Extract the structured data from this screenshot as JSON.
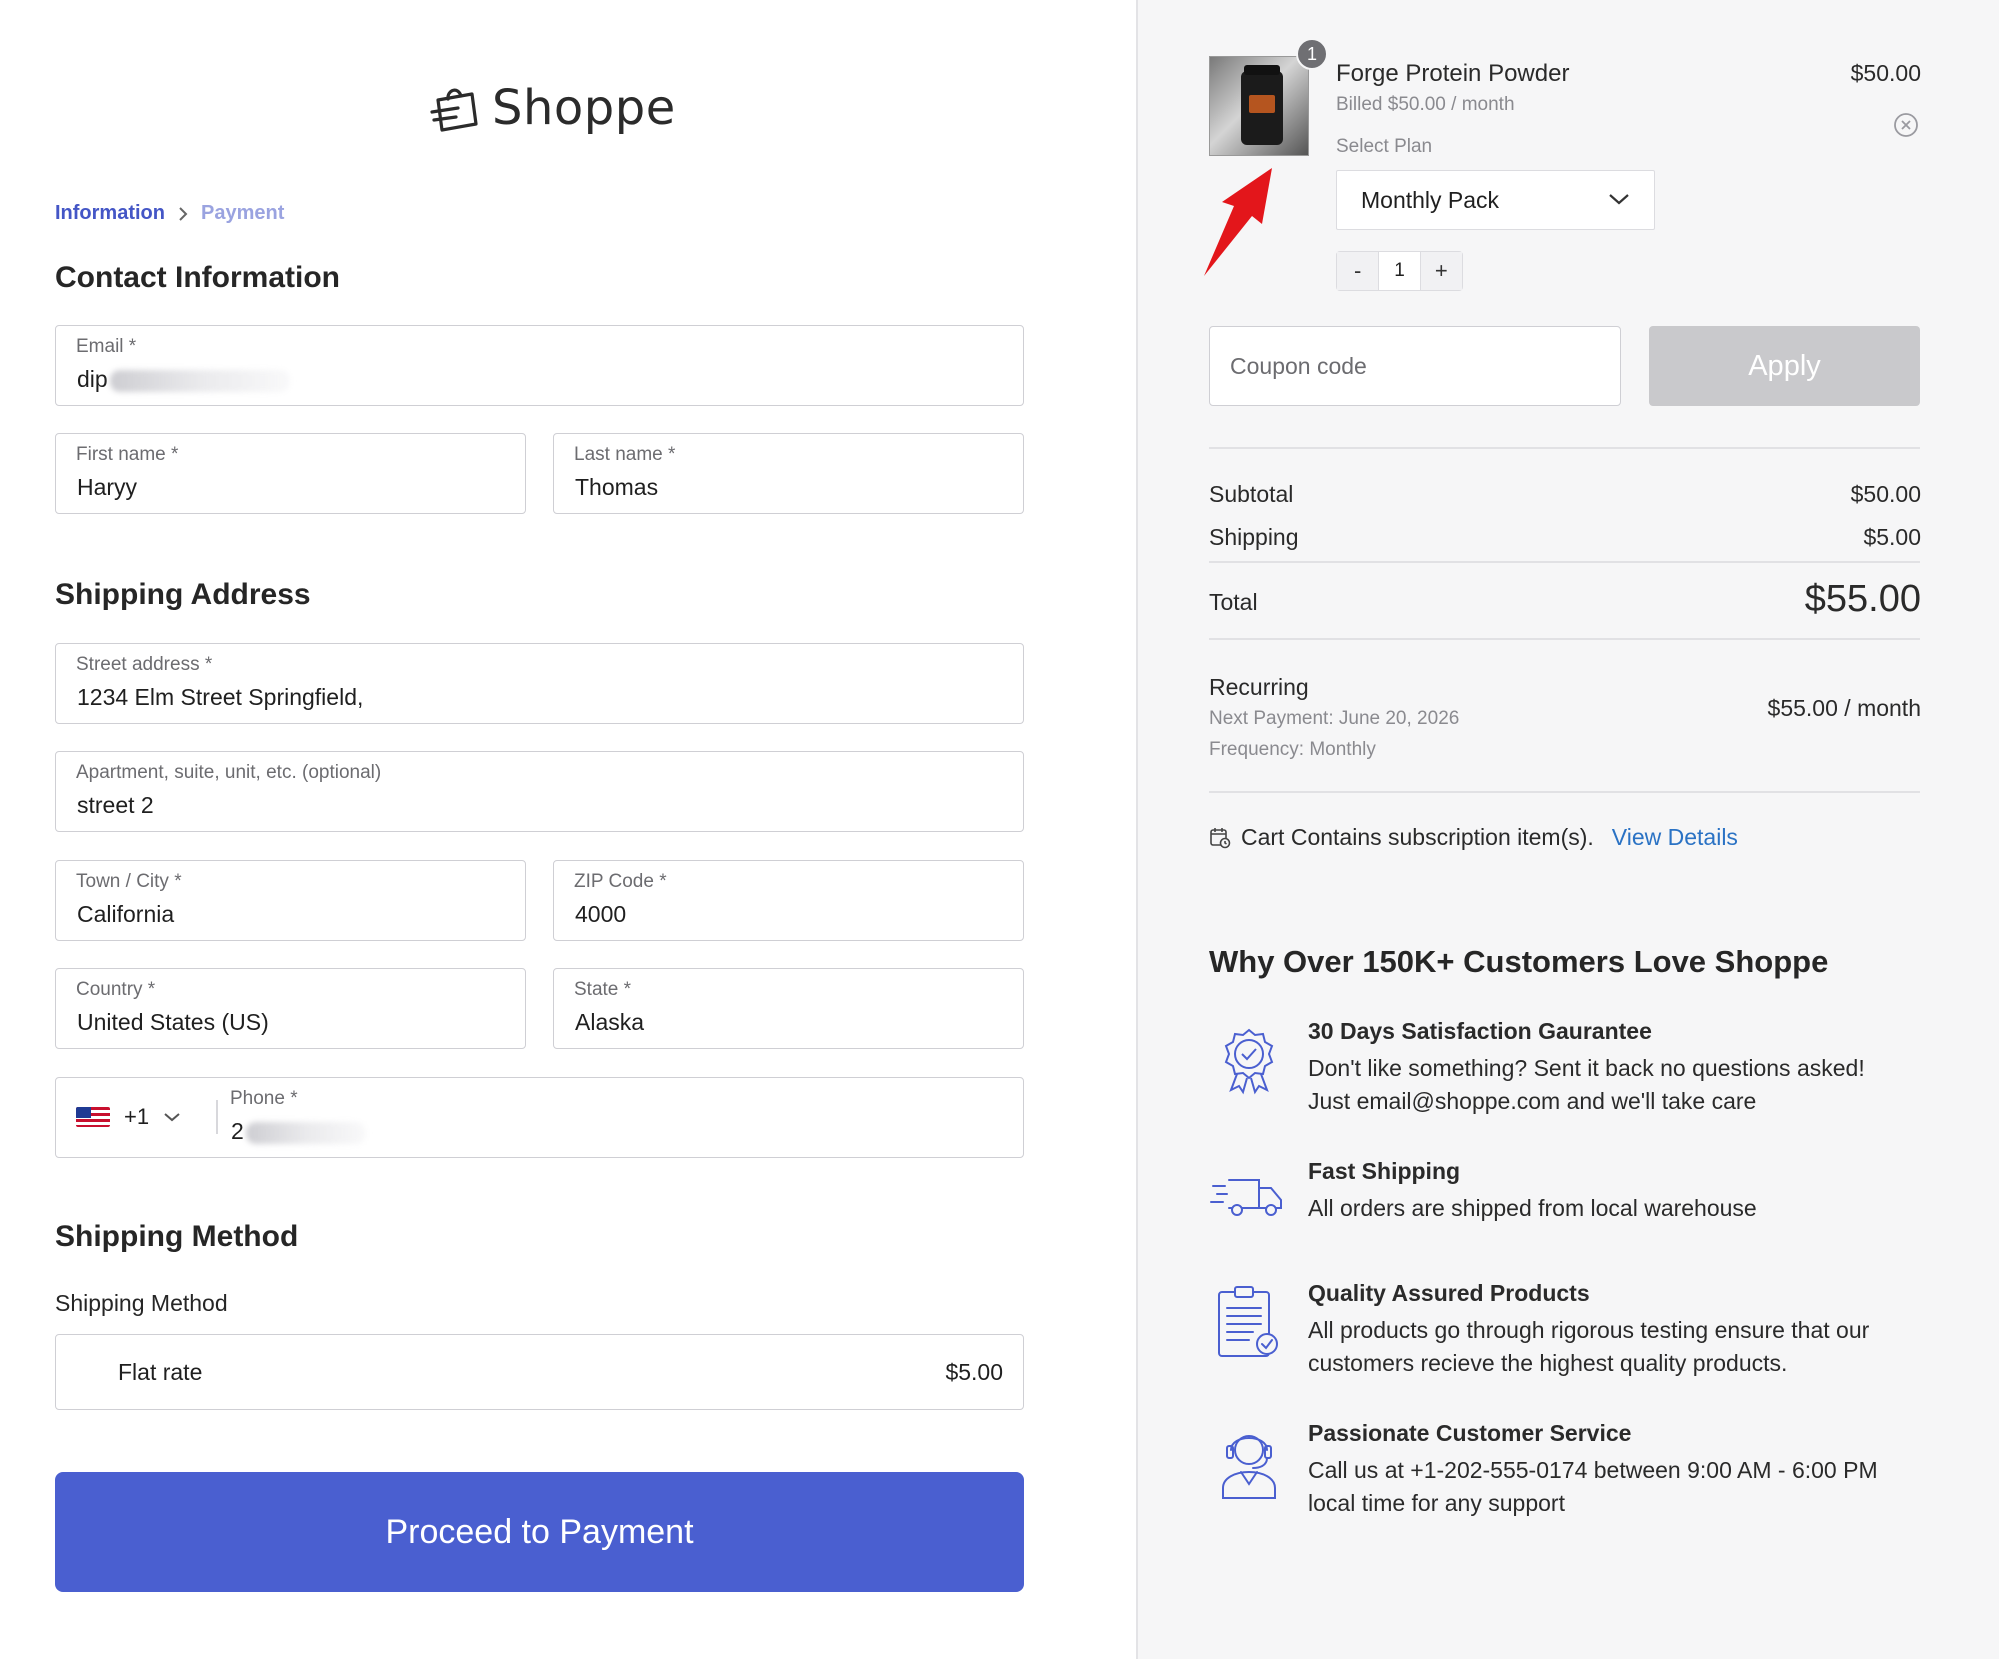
{
  "brand": {
    "name": "Shoppe",
    "accent": "#4a5fd0"
  },
  "breadcrumb": {
    "current": "Information",
    "next": "Payment"
  },
  "contact": {
    "title": "Contact Information",
    "email_label": "Email *",
    "email_value": "dip",
    "first_name_label": "First name *",
    "first_name_value": "Haryy",
    "last_name_label": "Last name *",
    "last_name_value": "Thomas"
  },
  "shipping_address": {
    "title": "Shipping Address",
    "street_label": "Street address *",
    "street_value": "1234 Elm Street Springfield,",
    "apt_label": "Apartment, suite, unit, etc. (optional)",
    "apt_value": "street 2",
    "city_label": "Town / City *",
    "city_value": "California",
    "zip_label": "ZIP Code *",
    "zip_value": "4000",
    "country_label": "Country *",
    "country_value": "United States (US)",
    "state_label": "State *",
    "state_value": "Alaska",
    "phone_code": "+1",
    "phone_label": "Phone *",
    "phone_value": "2"
  },
  "shipping_method": {
    "title": "Shipping Method",
    "label": "Shipping Method",
    "rate_name": "Flat rate",
    "rate_price": "$5.00"
  },
  "proceed_label": "Proceed to Payment",
  "cart": {
    "quantity_badge": "1",
    "product_name": "Forge Protein Powder",
    "billed": "Billed $50.00 / month",
    "price": "$50.00",
    "plan_label": "Select Plan",
    "plan_value": "Monthly Pack",
    "qty_minus": "-",
    "qty_value": "1",
    "qty_plus": "+",
    "coupon_placeholder": "Coupon code",
    "apply_label": "Apply"
  },
  "totals": {
    "subtotal_label": "Subtotal",
    "subtotal_value": "$50.00",
    "shipping_label": "Shipping",
    "shipping_value": "$5.00",
    "total_label": "Total",
    "total_value": "$55.00",
    "recurring_label": "Recurring",
    "next_payment": "Next Payment: June 20, 2026",
    "frequency": "Frequency: Monthly",
    "recurring_value": "$55.00 / month"
  },
  "subscription_note": {
    "text": "Cart Contains subscription item(s).",
    "link": "View Details"
  },
  "why": {
    "title": "Why Over 150K+ Customers Love Shoppe",
    "benefits": [
      {
        "title": "30 Days Satisfaction Gaurantee",
        "line1": "Don't like something? Sent it back no questions asked!",
        "line2": "Just email@shoppe.com and we'll take care",
        "icon": "badge-check-icon"
      },
      {
        "title": "Fast Shipping",
        "line1": "All orders are shipped from local warehouse",
        "line2": "",
        "icon": "truck-icon"
      },
      {
        "title": "Quality Assured Products",
        "line1": "All products go through rigorous testing ensure that our",
        "line2": "customers recieve the highest quality products.",
        "icon": "clipboard-check-icon"
      },
      {
        "title": "Passionate Customer Service",
        "line1": "Call us at +1-202-555-0174 between 9:00 AM - 6:00 PM",
        "line2": "local time for any support",
        "icon": "headset-agent-icon"
      }
    ]
  }
}
